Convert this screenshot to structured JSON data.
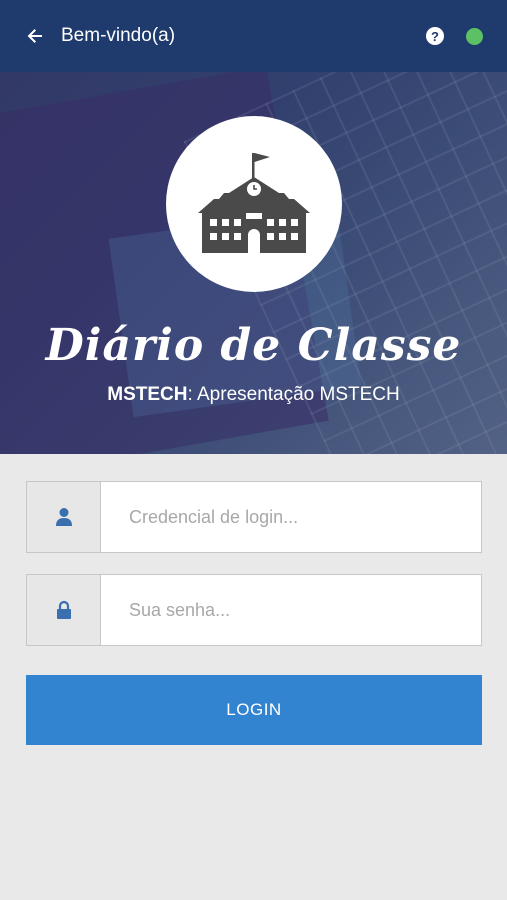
{
  "header": {
    "title": "Bem-vindo(a)",
    "back_icon": "arrow-left-icon",
    "help_label": "?",
    "status_color": "#5cc065"
  },
  "hero": {
    "app_name": "Diário de Classe",
    "org": "MSTECH",
    "separator": ": ",
    "description": "Apresentação MSTECH",
    "logo_icon": "school-building-icon"
  },
  "form": {
    "login": {
      "placeholder": "Credencial de login...",
      "value": "",
      "icon": "user-icon"
    },
    "password": {
      "placeholder": "Sua senha...",
      "value": "",
      "icon": "lock-icon"
    },
    "submit_label": "LOGIN"
  },
  "colors": {
    "header_bg": "#1f3a6d",
    "accent": "#3384d0",
    "background": "#e9e9e9"
  }
}
